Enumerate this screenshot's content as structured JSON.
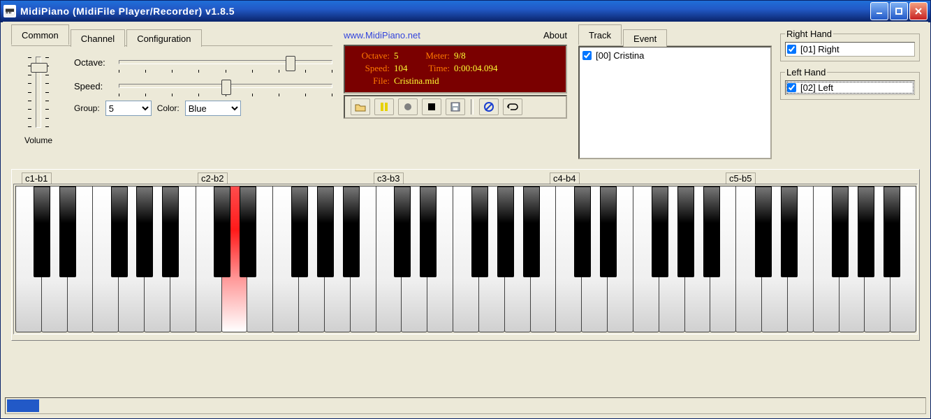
{
  "window": {
    "title": "MidiPiano (MidiFile Player/Recorder) v1.8.5"
  },
  "tabs_left": [
    {
      "label": "Common",
      "active": true
    },
    {
      "label": "Channel",
      "active": false
    },
    {
      "label": "Configuration",
      "active": false
    }
  ],
  "tabs_right": [
    {
      "label": "Track",
      "active": true
    },
    {
      "label": "Event",
      "active": false
    }
  ],
  "link": "www.MidiPiano.net",
  "about": "About",
  "volume_label": "Volume",
  "controls": {
    "octave_label": "Octave:",
    "speed_label": "Speed:",
    "group_label": "Group:",
    "group_value": "5",
    "color_label": "Color:",
    "color_value": "Blue"
  },
  "display": {
    "octave_label": "Octave:",
    "octave_value": "5",
    "meter_label": "Meter:",
    "meter_value": "9/8",
    "speed_label": "Speed:",
    "speed_value": "104",
    "time_label": "Time:",
    "time_value": "0:00:04.094",
    "file_label": "File:",
    "file_value": "Cristina.mid"
  },
  "transport_icons": [
    "open",
    "pause",
    "record",
    "stop",
    "save",
    "reset",
    "loop"
  ],
  "tracks": [
    {
      "label": "[00] Cristina",
      "checked": true
    }
  ],
  "right_hand": {
    "legend": "Right Hand",
    "items": [
      {
        "label": "[01] Right",
        "checked": true
      }
    ]
  },
  "left_hand": {
    "legend": "Left Hand",
    "items": [
      {
        "label": "[02] Left",
        "checked": true
      }
    ]
  },
  "octave_ranges": [
    "c1-b1",
    "c2-b2",
    "c3-b3",
    "c4-b4",
    "c5-b5"
  ],
  "pressed_white_key_index": 8,
  "status_progress_percent": 4
}
